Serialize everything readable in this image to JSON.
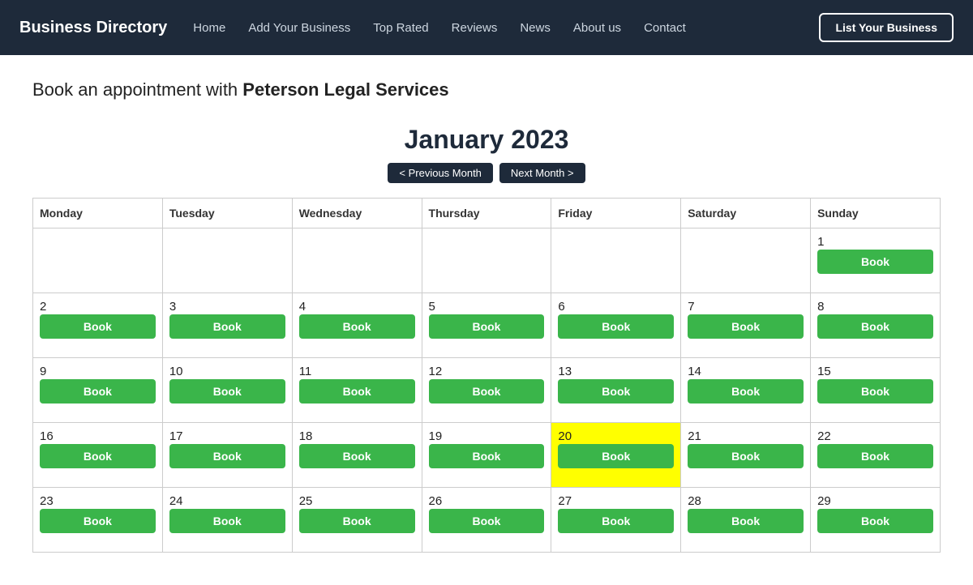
{
  "nav": {
    "brand": "Business Directory",
    "links": [
      {
        "label": "Home",
        "name": "home"
      },
      {
        "label": "Add Your Business",
        "name": "add-your-business"
      },
      {
        "label": "Top Rated",
        "name": "top-rated"
      },
      {
        "label": "Reviews",
        "name": "reviews"
      },
      {
        "label": "News",
        "name": "news"
      },
      {
        "label": "About us",
        "name": "about-us"
      },
      {
        "label": "Contact",
        "name": "contact"
      }
    ],
    "cta": "List Your Business"
  },
  "page": {
    "title_prefix": "Book an appointment with ",
    "business_name": "Peterson Legal Services"
  },
  "calendar": {
    "month_title": "January 2023",
    "prev_label": "< Previous Month",
    "next_label": "Next Month >",
    "day_headers": [
      "Monday",
      "Tuesday",
      "Wednesday",
      "Thursday",
      "Friday",
      "Saturday",
      "Sunday"
    ],
    "book_label": "Book",
    "rows": [
      [
        {
          "day": "",
          "book": false,
          "empty": true
        },
        {
          "day": "",
          "book": false,
          "empty": true
        },
        {
          "day": "",
          "book": false,
          "empty": true
        },
        {
          "day": "",
          "book": false,
          "empty": true
        },
        {
          "day": "",
          "book": false,
          "empty": true
        },
        {
          "day": "",
          "book": false,
          "empty": true
        },
        {
          "day": "1",
          "book": true,
          "highlight": false
        }
      ],
      [
        {
          "day": "2",
          "book": true,
          "highlight": false
        },
        {
          "day": "3",
          "book": true,
          "highlight": false
        },
        {
          "day": "4",
          "book": true,
          "highlight": false
        },
        {
          "day": "5",
          "book": true,
          "highlight": false
        },
        {
          "day": "6",
          "book": true,
          "highlight": false
        },
        {
          "day": "7",
          "book": true,
          "highlight": false
        },
        {
          "day": "8",
          "book": true,
          "highlight": false
        }
      ],
      [
        {
          "day": "9",
          "book": true,
          "highlight": false
        },
        {
          "day": "10",
          "book": true,
          "highlight": false
        },
        {
          "day": "11",
          "book": true,
          "highlight": false
        },
        {
          "day": "12",
          "book": true,
          "highlight": false
        },
        {
          "day": "13",
          "book": true,
          "highlight": false
        },
        {
          "day": "14",
          "book": true,
          "highlight": false
        },
        {
          "day": "15",
          "book": true,
          "highlight": false
        }
      ],
      [
        {
          "day": "16",
          "book": true,
          "highlight": false
        },
        {
          "day": "17",
          "book": true,
          "highlight": false
        },
        {
          "day": "18",
          "book": true,
          "highlight": false
        },
        {
          "day": "19",
          "book": true,
          "highlight": false
        },
        {
          "day": "20",
          "book": true,
          "highlight": true
        },
        {
          "day": "21",
          "book": true,
          "highlight": false
        },
        {
          "day": "22",
          "book": true,
          "highlight": false
        }
      ],
      [
        {
          "day": "23",
          "book": true,
          "highlight": false
        },
        {
          "day": "24",
          "book": true,
          "highlight": false
        },
        {
          "day": "25",
          "book": true,
          "highlight": false
        },
        {
          "day": "26",
          "book": true,
          "highlight": false
        },
        {
          "day": "27",
          "book": true,
          "highlight": false
        },
        {
          "day": "28",
          "book": true,
          "highlight": false
        },
        {
          "day": "29",
          "book": true,
          "highlight": false
        }
      ]
    ]
  }
}
